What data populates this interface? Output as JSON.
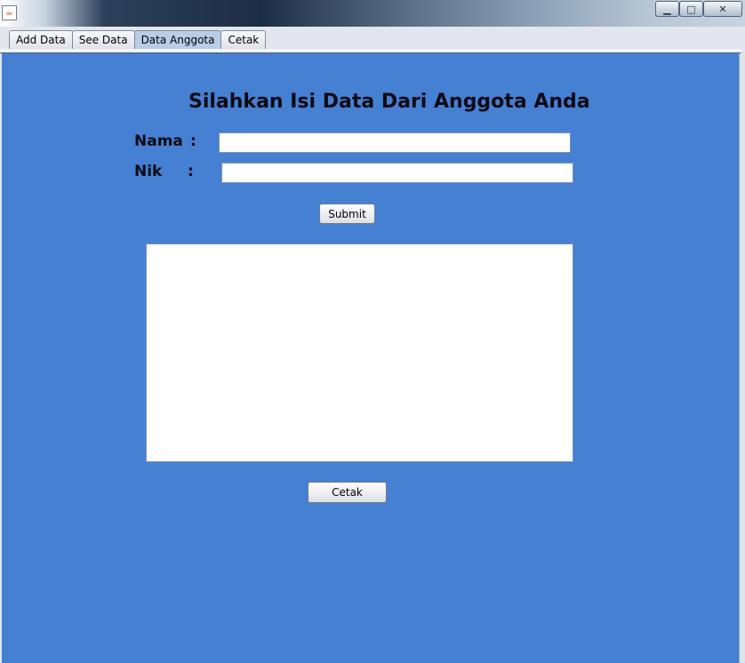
{
  "window": {
    "app_icon": "java-coffee-icon",
    "controls": {
      "minimize": "minimize-icon",
      "maximize": "maximize-icon",
      "close": "close-icon"
    }
  },
  "tabs": [
    {
      "label": "Add Data"
    },
    {
      "label": "See Data"
    },
    {
      "label": "Data Anggota"
    },
    {
      "label": "Cetak"
    }
  ],
  "active_tab": "Data Anggota",
  "form": {
    "heading": "Silahkan Isi Data Dari Anggota Anda",
    "nama_label": "Nama",
    "nik_label": "Nik",
    "colon": ":",
    "nama_value": "",
    "nik_value": "",
    "submit_label": "Submit",
    "output_text": "",
    "cetak_label": "Cetak"
  },
  "colors": {
    "panel_background": "#4580d3",
    "text": "#0a0a14"
  }
}
